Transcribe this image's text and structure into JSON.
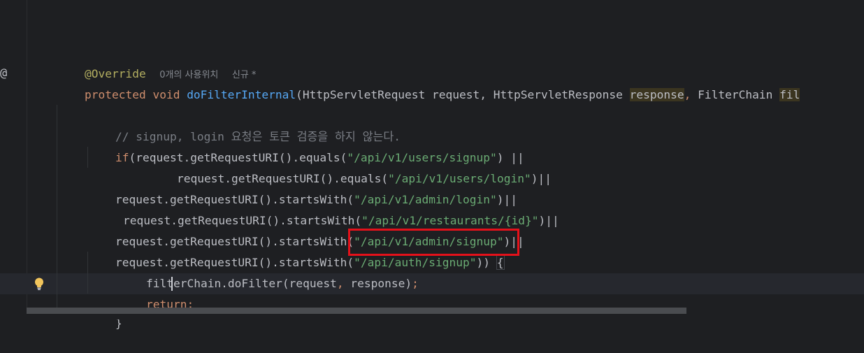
{
  "editor": {
    "gutter_marker": "@",
    "hints": {
      "usages": "0개의 사용위치",
      "new_marker": "신규 *"
    },
    "code": {
      "annotation": "@Override",
      "modifier": "protected",
      "return_type": "void",
      "method_name": "doFilterInternal",
      "sig_open": "(HttpServletRequest request, HttpServletResponse ",
      "param_response": "response",
      "sig_comma": ",",
      "sig_rest": " FilterChain ",
      "param_fil": "fil",
      "comment": "// signup, login 요청은 토큰 검증을 하지 않는다.",
      "if_kw": "if",
      "l1_pre": "(request.getRequestURI().equals(",
      "l1_str": "\"/api/v1/users/signup\"",
      "l1_post": ") ||",
      "l2_pre": "request.getRequestURI().equals(",
      "l2_str": "\"/api/v1/users/login\"",
      "l2_post": ")||",
      "l3_pre": "request.getRequestURI().startsWith(",
      "l3_str": "\"/api/v1/admin/login\"",
      "l3_post": ")||",
      "l4_pre": "request.getRequestURI().startsWith(",
      "l4_str": "\"/api/v1/restaurants/{id}\"",
      "l4_post": ")||",
      "l5_pre": "request.getRequestURI().startsWith(",
      "l5_str": "\"/api/v1/admin/signup\"",
      "l5_post": ")||",
      "l6_pre": "request.getRequestURI().startsWith(",
      "l6_str": "\"/api/auth/signup\"",
      "l6_post": ")) ",
      "l6_brace": "{",
      "call_pre": "filterChain.doFilter(request",
      "call_comma": ",",
      "call_post": " response)",
      "call_semi": ";",
      "return_kw": "return",
      "return_semi": ";",
      "close_brace": "}"
    }
  },
  "colors": {
    "background": "#1e1f22",
    "keyword": "#cf8e6d",
    "string": "#6aab73",
    "function": "#56a8f5",
    "annotation": "#b3ae60",
    "highlight_box": "#e4111a"
  }
}
